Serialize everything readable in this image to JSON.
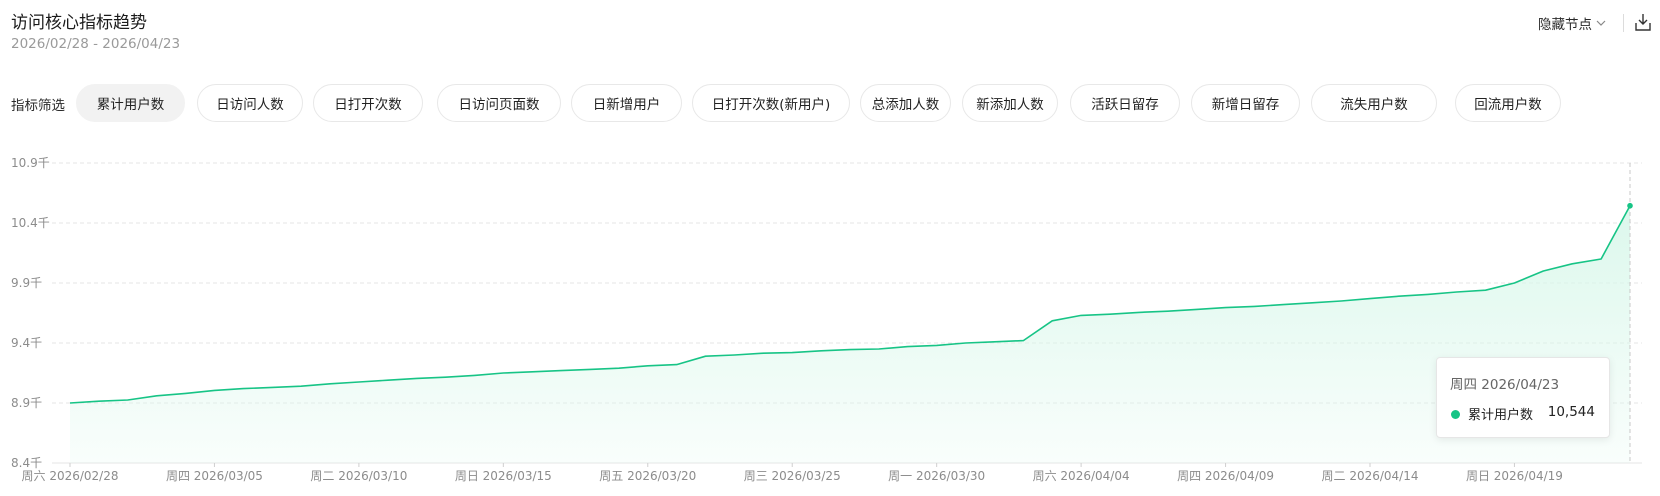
{
  "header": {
    "title": "访问核心指标趋势",
    "date_range": "2026/02/28 - 2026/04/23",
    "hide_nodes_label": "隐藏节点",
    "export_icon": "export-icon"
  },
  "filter": {
    "label": "指标筛选",
    "chips": [
      "累计用户数",
      "日访问人数",
      "日打开次数",
      "日访问页面数",
      "日新增用户",
      "日打开次数(新用户)",
      "总添加人数",
      "新添加人数",
      "活跃日留存",
      "新增日留存",
      "流失用户数",
      "回流用户数"
    ],
    "active_index": 0
  },
  "tooltip": {
    "date": "周四 2026/04/23",
    "series_name": "累计用户数",
    "value": "10,544"
  },
  "colors": {
    "line": "#17c486",
    "area_top": "#d8f7ea",
    "grid": "#e6e6e6",
    "axis_text": "#8c8c8c"
  },
  "chart_data": {
    "type": "area",
    "title": "",
    "xlabel": "",
    "ylabel": "",
    "ylim": [
      8400,
      10900
    ],
    "y_ticks": [
      "8.4千",
      "8.9千",
      "9.4千",
      "9.9千",
      "10.4千",
      "10.9千"
    ],
    "x_tick_labels": [
      "周六 2026/02/28",
      "周四 2026/03/05",
      "周二 2026/03/10",
      "周日 2026/03/15",
      "周五 2026/03/20",
      "周三 2026/03/25",
      "周一 2026/03/30",
      "周六 2026/04/04",
      "周四 2026/04/09",
      "周二 2026/04/14",
      "周日 2026/04/19"
    ],
    "grid": true,
    "series": [
      {
        "name": "累计用户数",
        "x": [
          "02/28",
          "03/01",
          "03/02",
          "03/03",
          "03/04",
          "03/05",
          "03/06",
          "03/07",
          "03/08",
          "03/09",
          "03/10",
          "03/11",
          "03/12",
          "03/13",
          "03/14",
          "03/15",
          "03/16",
          "03/17",
          "03/18",
          "03/19",
          "03/20",
          "03/21",
          "03/22",
          "03/23",
          "03/24",
          "03/25",
          "03/26",
          "03/27",
          "03/28",
          "03/29",
          "03/30",
          "03/31",
          "04/01",
          "04/02",
          "04/03",
          "04/04",
          "04/05",
          "04/06",
          "04/07",
          "04/08",
          "04/09",
          "04/10",
          "04/11",
          "04/12",
          "04/13",
          "04/14",
          "04/15",
          "04/16",
          "04/17",
          "04/18",
          "04/19",
          "04/20",
          "04/21",
          "04/22",
          "04/23"
        ],
        "values": [
          8900,
          8915,
          8925,
          8960,
          8980,
          9005,
          9020,
          9030,
          9040,
          9060,
          9075,
          9090,
          9105,
          9115,
          9130,
          9150,
          9160,
          9170,
          9180,
          9190,
          9210,
          9220,
          9290,
          9300,
          9315,
          9320,
          9335,
          9345,
          9350,
          9370,
          9380,
          9400,
          9410,
          9420,
          9585,
          9630,
          9640,
          9655,
          9665,
          9680,
          9695,
          9705,
          9720,
          9735,
          9750,
          9770,
          9790,
          9805,
          9825,
          9840,
          9900,
          10000,
          10060,
          10100,
          10544
        ]
      }
    ]
  }
}
